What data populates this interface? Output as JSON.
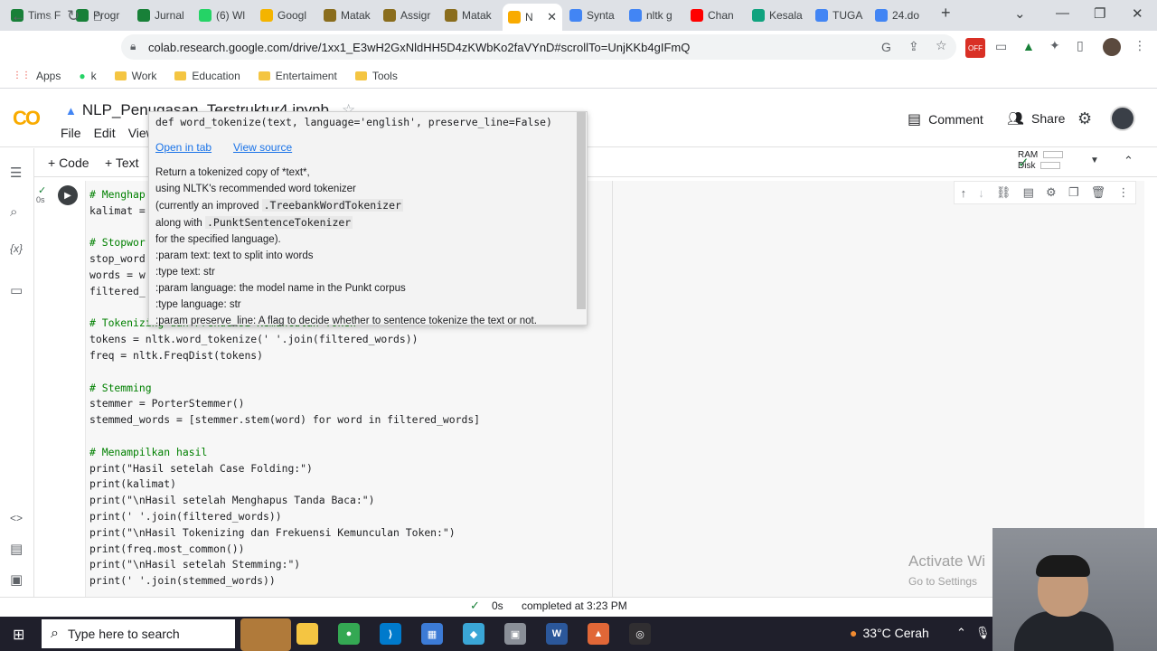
{
  "browser": {
    "tabs": [
      {
        "label": "Tims F",
        "color": "#188038",
        "icon": "sheets-icon"
      },
      {
        "label": "Progr",
        "color": "#188038",
        "icon": "sheets-icon"
      },
      {
        "label": "Jurnal",
        "color": "#188038",
        "icon": "sheets-icon"
      },
      {
        "label": "(6) Wl",
        "color": "#25d366",
        "icon": "whatsapp-icon"
      },
      {
        "label": "Googl",
        "color": "#f4b400",
        "icon": "keep-icon"
      },
      {
        "label": "Matak",
        "color": "#8a6d1d",
        "icon": "campus-icon"
      },
      {
        "label": "Assigr",
        "color": "#8a6d1d",
        "icon": "campus-icon"
      },
      {
        "label": "Matak",
        "color": "#8a6d1d",
        "icon": "campus-icon"
      },
      {
        "label": "N",
        "color": "#f9ab00",
        "icon": "colab-icon"
      },
      {
        "label": "Synta",
        "color": "#4285f4",
        "icon": "google-icon"
      },
      {
        "label": "nltk g",
        "color": "#4285f4",
        "icon": "google-icon"
      },
      {
        "label": "Chan",
        "color": "#ff0000",
        "icon": "youtube-icon"
      },
      {
        "label": "Kesala",
        "color": "#10a37f",
        "icon": "chatgpt-icon"
      },
      {
        "label": "TUGA",
        "color": "#4285f4",
        "icon": "drive-icon"
      },
      {
        "label": "24.do",
        "color": "#4285f4",
        "icon": "docs-icon"
      }
    ],
    "url": "colab.research.google.com/drive/1xx1_E3wH2GxNldHH5D4zKWbKo2faVYnD#scrollTo=UnjKKb4gIFmQ",
    "bookmarks": [
      {
        "label": "Apps",
        "icon": "apps-icon"
      },
      {
        "label": "k",
        "icon": "whatsapp-icon"
      },
      {
        "label": "Work",
        "icon": "folder-icon"
      },
      {
        "label": "Education",
        "icon": "folder-icon"
      },
      {
        "label": "Entertaiment",
        "icon": "folder-icon"
      },
      {
        "label": "Tools",
        "icon": "folder-icon"
      }
    ],
    "off_badge": "OFF"
  },
  "colab": {
    "logo": "CO",
    "title": "NLP_Penugasan_Terstruktur4.ipynb",
    "menu": [
      "File",
      "Edit",
      "View"
    ],
    "comment_label": "Comment",
    "share_label": "Share",
    "add_code": "+ Code",
    "add_text": "+ Text",
    "ram_label": "RAM",
    "disk_label": "Disk"
  },
  "cell": {
    "exec_time": "0s",
    "code_lines": [
      {
        "t": "# Menghap",
        "c": "cmt"
      },
      {
        "t": "kalimat = ",
        "c": ""
      },
      {
        "t": "",
        "c": ""
      },
      {
        "t": "# Stopwor",
        "c": "cmt"
      },
      {
        "t": "stop_word",
        "c": ""
      },
      {
        "t": "words = w",
        "c": ""
      },
      {
        "t": "filtered_",
        "c": ""
      },
      {
        "t": "",
        "c": ""
      },
      {
        "t": "# Tokenizing dan Frekuensi Kemunculan Token",
        "c": "cmt"
      },
      {
        "t": "tokens = nltk.word_tokenize(' '.join(filtered_words))",
        "c": ""
      },
      {
        "t": "freq = nltk.FreqDist(tokens)",
        "c": ""
      },
      {
        "t": "",
        "c": ""
      },
      {
        "t": "# Stemming",
        "c": "cmt"
      },
      {
        "t": "stemmer = PorterStemmer()",
        "c": ""
      },
      {
        "t": "stemmed_words = [stemmer.stem(word) for word in filtered_words]",
        "c": ""
      },
      {
        "t": "",
        "c": ""
      },
      {
        "t": "# Menampilkan hasil",
        "c": "cmt"
      },
      {
        "t": "print(\"Hasil setelah Case Folding:\")",
        "c": ""
      },
      {
        "t": "print(kalimat)",
        "c": ""
      },
      {
        "t": "print(\"\\nHasil setelah Menghapus Tanda Baca:\")",
        "c": ""
      },
      {
        "t": "print(' '.join(filtered_words))",
        "c": ""
      },
      {
        "t": "print(\"\\nHasil Tokenizing dan Frekuensi Kemunculan Token:\")",
        "c": ""
      },
      {
        "t": "print(freq.most_common())",
        "c": ""
      },
      {
        "t": "print(\"\\nHasil setelah Stemming:\")",
        "c": ""
      },
      {
        "t": "print(' '.join(stemmed_words))",
        "c": ""
      }
    ]
  },
  "tooltip": {
    "signature": "def word_tokenize(text, language='english', preserve_line=False)",
    "open_in_tab": "Open in tab",
    "view_source": "View source",
    "doc_lines": [
      {
        "t": "Return a tokenized copy of *text*,",
        "m": ""
      },
      {
        "t": "using NLTK's recommended word tokenizer",
        "m": ""
      },
      {
        "t": "(currently an improved ",
        "m": ".TreebankWordTokenizer"
      },
      {
        "t": "along with ",
        "m": ".PunktSentenceTokenizer"
      },
      {
        "t": "for the specified language).",
        "m": ""
      },
      {
        "t": ":param text: text to split into words",
        "m": ""
      },
      {
        "t": ":type text: str",
        "m": ""
      },
      {
        "t": ":param language: the model name in the Punkt corpus",
        "m": ""
      },
      {
        "t": ":type language: str",
        "m": ""
      },
      {
        "t": ":param preserve_line: A flag to decide whether to sentence tokenize the text or not.",
        "m": ""
      }
    ]
  },
  "status": {
    "time": "0s",
    "text": "completed at 3:23 PM"
  },
  "watermark": {
    "title": "Activate Wi",
    "subtitle": "Go to Settings"
  },
  "taskbar": {
    "search_placeholder": "Type here to search",
    "weather": "33°C  Cerah",
    "apps": [
      {
        "name": "file-explorer-icon",
        "color": "#f4c542",
        "glyph": ""
      },
      {
        "name": "chrome-icon",
        "color": "#34a853",
        "glyph": "●"
      },
      {
        "name": "vscode-icon",
        "color": "#007acc",
        "glyph": "⟩"
      },
      {
        "name": "calculator-icon",
        "color": "#3c7bd6",
        "glyph": "▦"
      },
      {
        "name": "app-icon",
        "color": "#3aa6d6",
        "glyph": "◆"
      },
      {
        "name": "app2-icon",
        "color": "#8a8f98",
        "glyph": "▣"
      },
      {
        "name": "word-icon",
        "color": "#2b579a",
        "glyph": "W"
      },
      {
        "name": "matlab-icon",
        "color": "#e16737",
        "glyph": "▲"
      },
      {
        "name": "obs-icon",
        "color": "#302e31",
        "glyph": "◎"
      }
    ]
  }
}
